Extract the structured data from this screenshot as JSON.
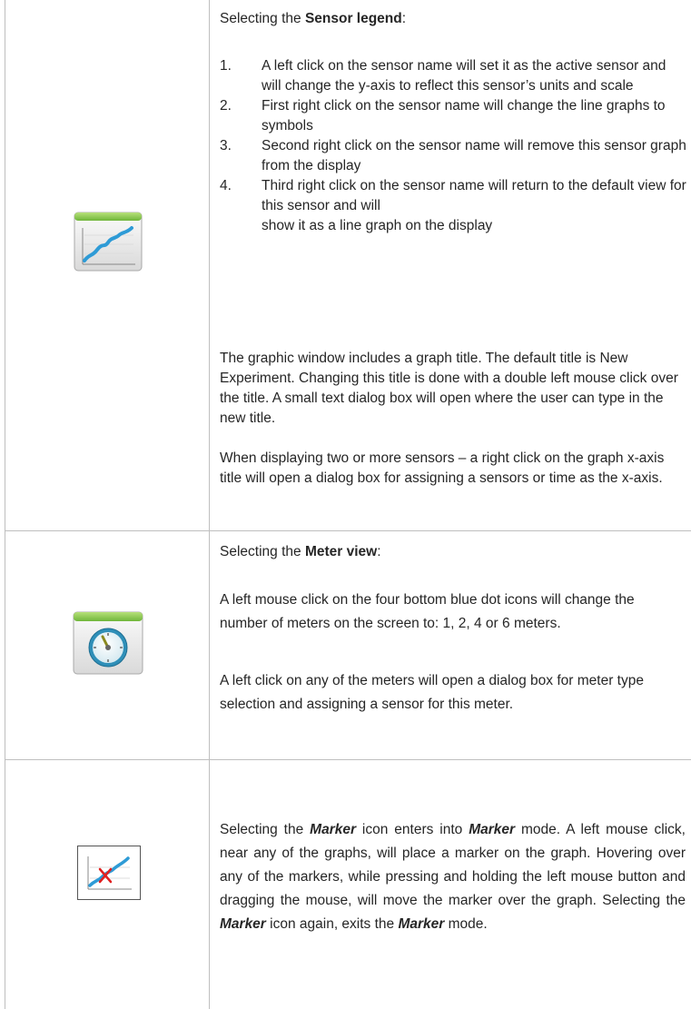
{
  "row1": {
    "heading_prefix": "Selecting the ",
    "heading_bold": "Sensor legend",
    "heading_suffix": ":",
    "items": [
      {
        "num": "1.",
        "text": "A left click on the sensor name will set it as the active sensor and will change the y-axis to reflect this sensor’s units and scale"
      },
      {
        "num": "2.",
        "text": "First right click on the sensor name will change the line graphs to symbols"
      },
      {
        "num": "3.",
        "text": "Second right click on the sensor name will remove this sensor graph from the display"
      },
      {
        "num": "4.",
        "text_line1": "Third right click on the sensor name will return to the default view for this sensor and will",
        "text_line2": "show it as a line graph on the display"
      }
    ],
    "para1": "The graphic window includes a graph title. The default title is New Experiment. Changing this title is done with a double left mouse click over the title. A small text dialog box will open where the user can type in the new title.",
    "para2": "When displaying two or more sensors – a right click on the graph x-axis title will open a dialog box for assigning a sensors or time as the x-axis.",
    "icon": "graph-view-icon"
  },
  "row2": {
    "heading_prefix": "Selecting the ",
    "heading_bold": "Meter view",
    "heading_suffix": ":",
    "para1": "A left mouse click on the four bottom blue dot icons will change the number of meters on the screen to: 1, 2, 4 or 6 meters.",
    "para2": "A left click on any of the meters will open a dialog box for meter type selection and assigning a sensor for this meter.",
    "icon": "meter-view-icon"
  },
  "row3": {
    "s1": "Selecting the ",
    "marker": "Marker",
    "s2": " icon enters into ",
    "s3": " mode. A left mouse click, near any of the graphs, will place a marker on the graph. Hovering over any of the markers, while pressing and holding the left mouse button and dragging the mouse, will move the marker over the graph. Selecting the ",
    "s4": " icon again, exits the ",
    "s5": " mode.",
    "icon": "marker-icon"
  },
  "colors": {
    "border": "#bfbfbf",
    "icon_green": "#8cc63f",
    "icon_blue": "#2e9bd6",
    "marker_red": "#e02020"
  }
}
